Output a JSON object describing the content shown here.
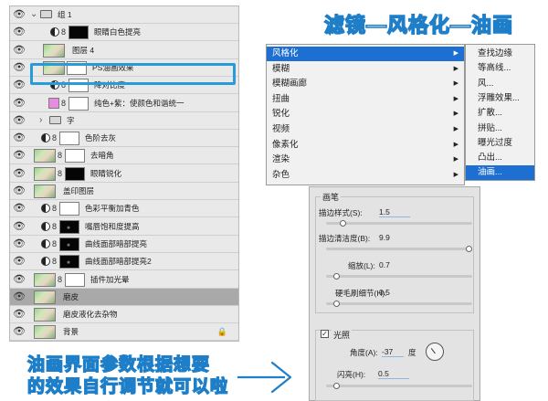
{
  "title": "滤镜—风格化—油画",
  "layers": [
    {
      "name": "组 1",
      "type": "group",
      "expanded": true
    },
    {
      "name": "眼睛白色提亮",
      "type": "adjustment",
      "mask": "black"
    },
    {
      "name": "图层 4",
      "type": "image"
    },
    {
      "name": "PS油画效果",
      "type": "smart",
      "highlighted": true
    },
    {
      "name": "降对比度",
      "type": "adjustment",
      "mask": "white"
    },
    {
      "name": "纯色+紫：使颜色和谐统一",
      "type": "fill",
      "mask": "white",
      "color": "#e58be0"
    },
    {
      "name": "字",
      "type": "group",
      "expanded": false
    },
    {
      "name": "色阶去灰",
      "type": "adjustment",
      "mask": "white"
    },
    {
      "name": "去暗角",
      "type": "image",
      "mask": "white"
    },
    {
      "name": "眼睛锐化",
      "type": "image",
      "mask": "black"
    },
    {
      "name": "盖印图层",
      "type": "image"
    },
    {
      "name": "色彩平衡加青色",
      "type": "adjustment",
      "mask": "white"
    },
    {
      "name": "嘴唇饱和度提高",
      "type": "adjustment",
      "mask": "black"
    },
    {
      "name": "曲线面部暗部提亮",
      "type": "adjustment",
      "mask": "black"
    },
    {
      "name": "曲线面部暗部提亮2",
      "type": "adjustment",
      "mask": "black"
    },
    {
      "name": "插件加光晕",
      "type": "image",
      "mask": "white"
    },
    {
      "name": "磨皮",
      "type": "image",
      "selected": true
    },
    {
      "name": "磨皮液化去杂物",
      "type": "image"
    },
    {
      "name": "背景",
      "type": "background",
      "locked": true
    }
  ],
  "menu": {
    "items": [
      {
        "label": "风格化",
        "active": true
      },
      {
        "label": "模糊"
      },
      {
        "label": "模糊画廊"
      },
      {
        "label": "扭曲"
      },
      {
        "label": "锐化"
      },
      {
        "label": "视频"
      },
      {
        "label": "像素化"
      },
      {
        "label": "渲染"
      },
      {
        "label": "杂色"
      }
    ],
    "arrow": "▶",
    "submenu": [
      {
        "label": "查找边缘"
      },
      {
        "label": "等高线..."
      },
      {
        "label": "风..."
      },
      {
        "label": "浮雕效果..."
      },
      {
        "label": "扩散..."
      },
      {
        "label": "拼贴..."
      },
      {
        "label": "曝光过度"
      },
      {
        "label": "凸出..."
      },
      {
        "label": "油画...",
        "active": true
      }
    ]
  },
  "dialog": {
    "brush": {
      "title": "画笔",
      "params": [
        {
          "label": "描边样式(S):",
          "value": "1.5",
          "fraction": 0.1,
          "editing": true
        },
        {
          "label": "描边清洁度(B):",
          "value": "9.9",
          "fraction": 1.0
        },
        {
          "label": "缩放(L):",
          "value": "0.7",
          "fraction": 0.05
        },
        {
          "label": "硬毛刷细节(H):",
          "value": "0.5",
          "fraction": 0.05
        }
      ]
    },
    "lighting": {
      "title": "光照",
      "checked": true,
      "check_mark": "✓",
      "angle_label": "角度(A):",
      "angle_value": "-37",
      "angle_unit": "度",
      "shine_label": "闪亮(H):",
      "shine_value": "0.5",
      "shine_fraction": 0.05
    }
  },
  "caption": {
    "line1": "油画界面参数根据想要",
    "line2": "的效果自行调节就可以啦"
  },
  "icons": {
    "eye": "👁",
    "chain": "8",
    "lock": "🔒",
    "chevron_open": "⌄",
    "chevron_closed": "›"
  }
}
